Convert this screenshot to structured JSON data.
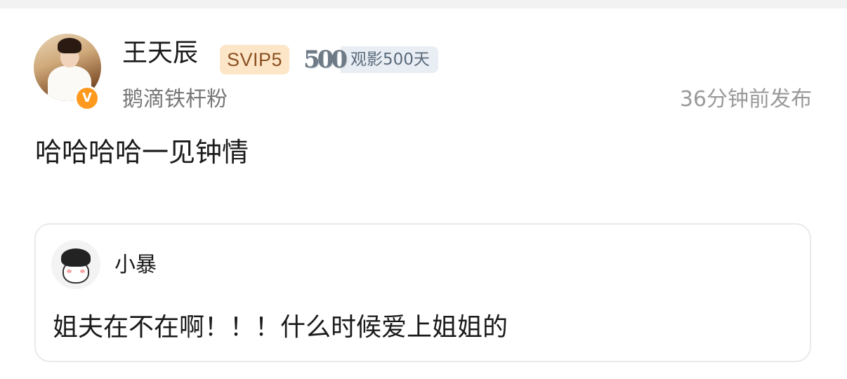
{
  "post": {
    "author": {
      "name": "王天辰",
      "vip_badge": "SVIP5",
      "watch_days_number": "500",
      "watch_days_label": "观影500天",
      "fan_tag": "鹅滴铁杆粉",
      "verified_mark": "V"
    },
    "time": "36分钟前发布",
    "content": "哈哈哈哈一见钟情"
  },
  "quote": {
    "author": "小暴",
    "content": "姐夫在不在啊！！！什么时候爱上姐姐的"
  },
  "colors": {
    "vip_bg": "#fde6c8",
    "vip_text": "#8a5020",
    "verified_badge": "#ff9a1f",
    "muted_text": "#9a9a9a",
    "card_border": "#e9e9e9"
  },
  "icons": {
    "verified": "verified-v-icon"
  }
}
